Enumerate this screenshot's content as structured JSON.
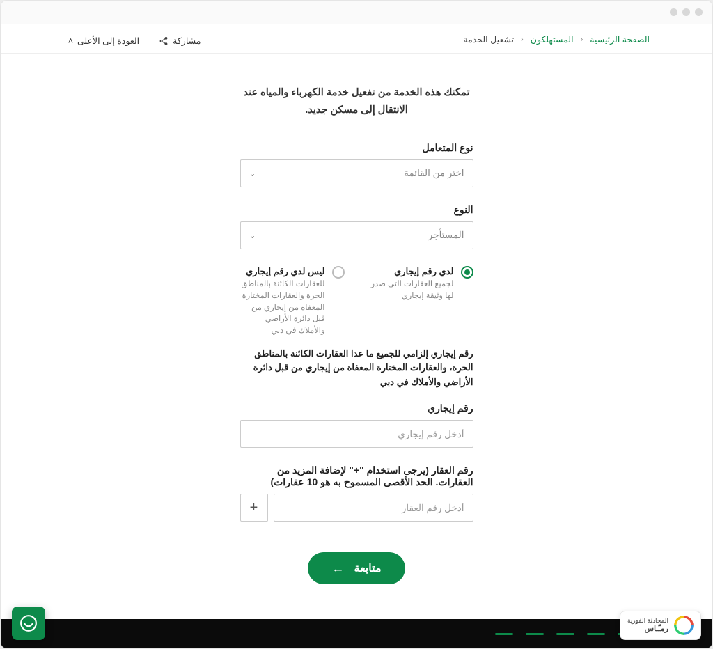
{
  "breadcrumbs": {
    "home": "الصفحة الرئيسية",
    "section": "المستهلكون",
    "current": "تشغيل الخدمة"
  },
  "actions": {
    "share": "مشاركة",
    "back_top": "العودة إلى الأعلى"
  },
  "intro": "تمكنك هذه الخدمة من تفعيل خدمة الكهرباء والمياه عند الانتقال إلى مسكن جديد.",
  "customer_type": {
    "label": "نوع المتعامل",
    "placeholder": "اختر من القائمة"
  },
  "type": {
    "label": "النوع",
    "selected": "المستأجر"
  },
  "radios": {
    "has": {
      "label": "لدي رقم إيجاري",
      "desc": "لجميع العقارات التي صدر لها وثيقة إيجاري"
    },
    "hasnot": {
      "label": "ليس لدي رقم إيجاري",
      "desc": "للعقارات الكائنة بالمناطق الحرة والعقارات المختارة المعفاة من إيجاري من قبل دائرة الأراضي والأملاك في دبي"
    }
  },
  "note": "رقم إيجاري إلزامي للجميع ما عدا العقارات الكائنة بالمناطق الحرة، والعقارات المختارة المعفاة من إيجاري من قبل دائرة الأراضي والأملاك في دبي",
  "ejari": {
    "label": "رقم إيجاري",
    "placeholder": "أدخل رقم إيجاري"
  },
  "property": {
    "label": "رقم العقار (يرجى استخدام \"+\" لإضافة المزيد من العقارات. الحد الأقصى المسموح به هو 10 عقارات)",
    "placeholder": "أدخل رقم العقار"
  },
  "cta": "متابعة",
  "badge": {
    "line1": "المحادثة الفورية",
    "line2": "رمـّـاس"
  }
}
